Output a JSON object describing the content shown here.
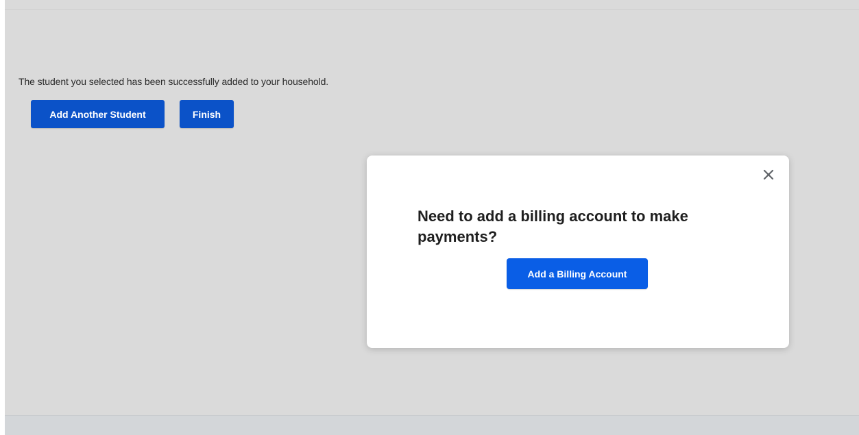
{
  "main": {
    "message": "The student you selected has been successfully added to your household.",
    "add_another_label": "Add Another Student",
    "finish_label": "Finish"
  },
  "modal": {
    "title": "Need to add a billing account to make payments?",
    "button_label": "Add a Billing Account",
    "close_icon": "close-icon"
  },
  "colors": {
    "primary_button": "#0b52c8",
    "modal_button": "#0a5ee6",
    "background": "#dadada"
  }
}
